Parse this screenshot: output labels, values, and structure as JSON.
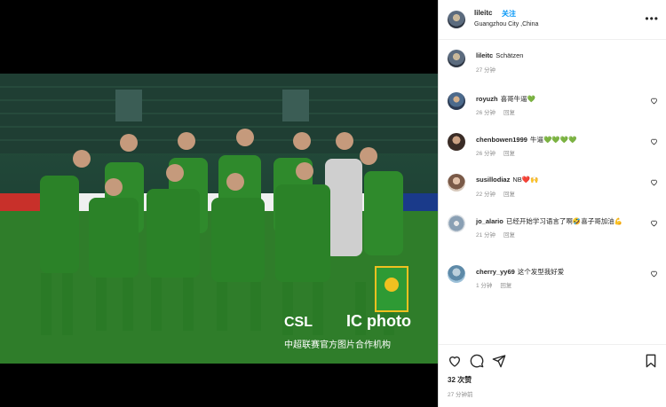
{
  "post": {
    "username": "lileitc",
    "follow_label": "关注",
    "location": "Guangzhou City ,China",
    "caption_user": "lileitc",
    "caption_text": "Schätzen",
    "caption_time": "27 分钟",
    "photo_watermark_logo": "CSL",
    "photo_watermark_brand": "IC photo",
    "photo_watermark_caption": "中超联赛官方图片合作机构"
  },
  "comments": [
    {
      "user": "royuzh",
      "text": "喜哥牛逼💚",
      "time": "26 分钟",
      "reply": "回复"
    },
    {
      "user": "chenbowen1999",
      "text": "牛逼💚💚💚💚",
      "time": "26 分钟",
      "reply": "回复"
    },
    {
      "user": "susillodiaz",
      "text": "NB❤️🙌",
      "time": "22 分钟",
      "reply": "回复"
    },
    {
      "user": "jo_alario",
      "text": "已经开始学习语言了啊🤣喜子哥加油💪",
      "time": "21 分钟",
      "reply": "回复"
    },
    {
      "user": "cherry_yy69",
      "text": "这个发型我好爱",
      "time": "1 分钟",
      "reply": "回复"
    }
  ],
  "footer": {
    "likes": "32 次赞",
    "timestamp": "27 分钟前"
  },
  "colors": {
    "accent": "#0095f6",
    "text": "#262626",
    "muted": "#8e8e8e",
    "jersey_green": "#2f8a2c"
  },
  "icons": [
    "more-icon",
    "heart-icon",
    "comment-icon",
    "share-icon",
    "bookmark-icon"
  ]
}
